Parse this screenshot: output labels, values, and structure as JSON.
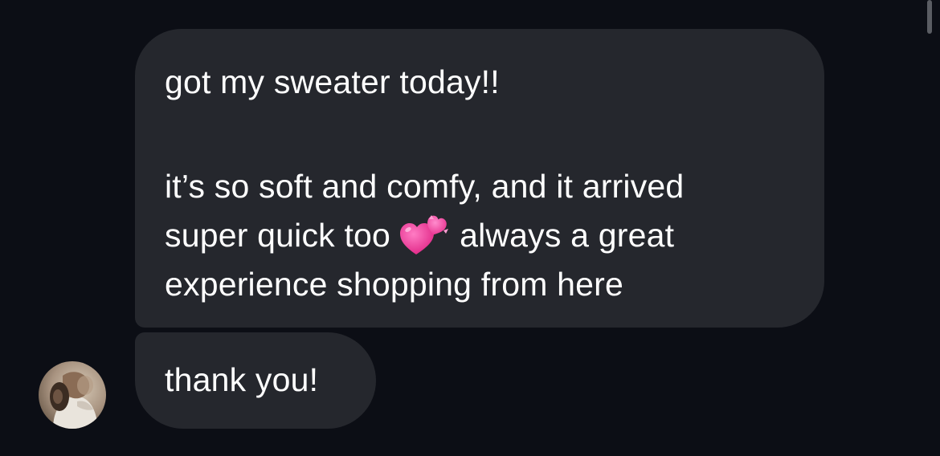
{
  "conversation": {
    "messages": [
      {
        "line1": "got my sweater today!!",
        "line2": "it’s so soft and comfy, and it arrived",
        "line3_before": "super quick too",
        "line3_emoji": "two-hearts-emoji",
        "line3_after": "always a great",
        "line4": "experience shopping from here"
      },
      {
        "text": "thank you!"
      }
    ],
    "avatar": {
      "icon": "profile-photo"
    },
    "colors": {
      "background": "#0c0e15",
      "bubble": "#25272d",
      "text": "#ffffff",
      "emoji_heart": "#f03c98"
    }
  }
}
